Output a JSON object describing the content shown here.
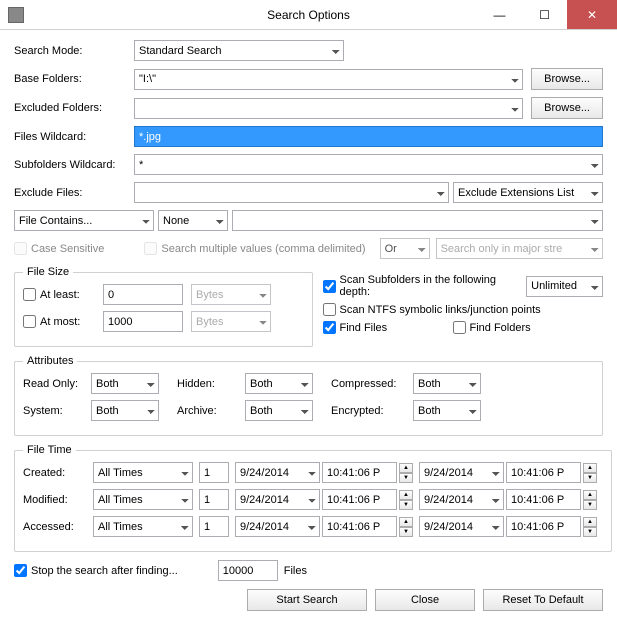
{
  "title": "Search Options",
  "labels": {
    "search_mode": "Search Mode:",
    "base_folders": "Base Folders:",
    "excluded_folders": "Excluded Folders:",
    "files_wildcard": "Files Wildcard:",
    "subfolders_wildcard": "Subfolders Wildcard:",
    "exclude_files": "Exclude Files:"
  },
  "values": {
    "search_mode": "Standard Search",
    "base_folders": "\"I:\\\"",
    "excluded_folders": "",
    "files_wildcard": "*.jpg",
    "subfolders_wildcard": "*",
    "exclude_files": "",
    "exclude_ext_list": "Exclude Extensions List",
    "file_contains": "File Contains...",
    "none": "None",
    "browse": "Browse...",
    "case_sensitive": "Case Sensitive",
    "search_multi": "Search multiple values (comma delimited)",
    "or": "Or",
    "search_major": "Search only in major stre"
  },
  "filesize": {
    "legend": "File Size",
    "at_least": "At least:",
    "at_most": "At most:",
    "least_val": "0",
    "most_val": "1000",
    "unit": "Bytes"
  },
  "scan": {
    "subfolders": "Scan Subfolders in the following depth:",
    "depth": "Unlimited",
    "ntfs": "Scan NTFS symbolic links/junction points",
    "find_files": "Find Files",
    "find_folders": "Find Folders"
  },
  "attrs": {
    "legend": "Attributes",
    "read_only": "Read Only:",
    "hidden": "Hidden:",
    "compressed": "Compressed:",
    "system": "System:",
    "archive": "Archive:",
    "encrypted": "Encrypted:",
    "both": "Both"
  },
  "filetime": {
    "legend": "File Time",
    "created": "Created:",
    "modified": "Modified:",
    "accessed": "Accessed:",
    "all_times": "All Times",
    "num": "1",
    "date": "9/24/2014",
    "time": "10:41:06 P"
  },
  "bottom": {
    "stop": "Stop the search after finding...",
    "count": "10000",
    "files": "Files",
    "start": "Start Search",
    "close": "Close",
    "reset": "Reset To Default"
  }
}
